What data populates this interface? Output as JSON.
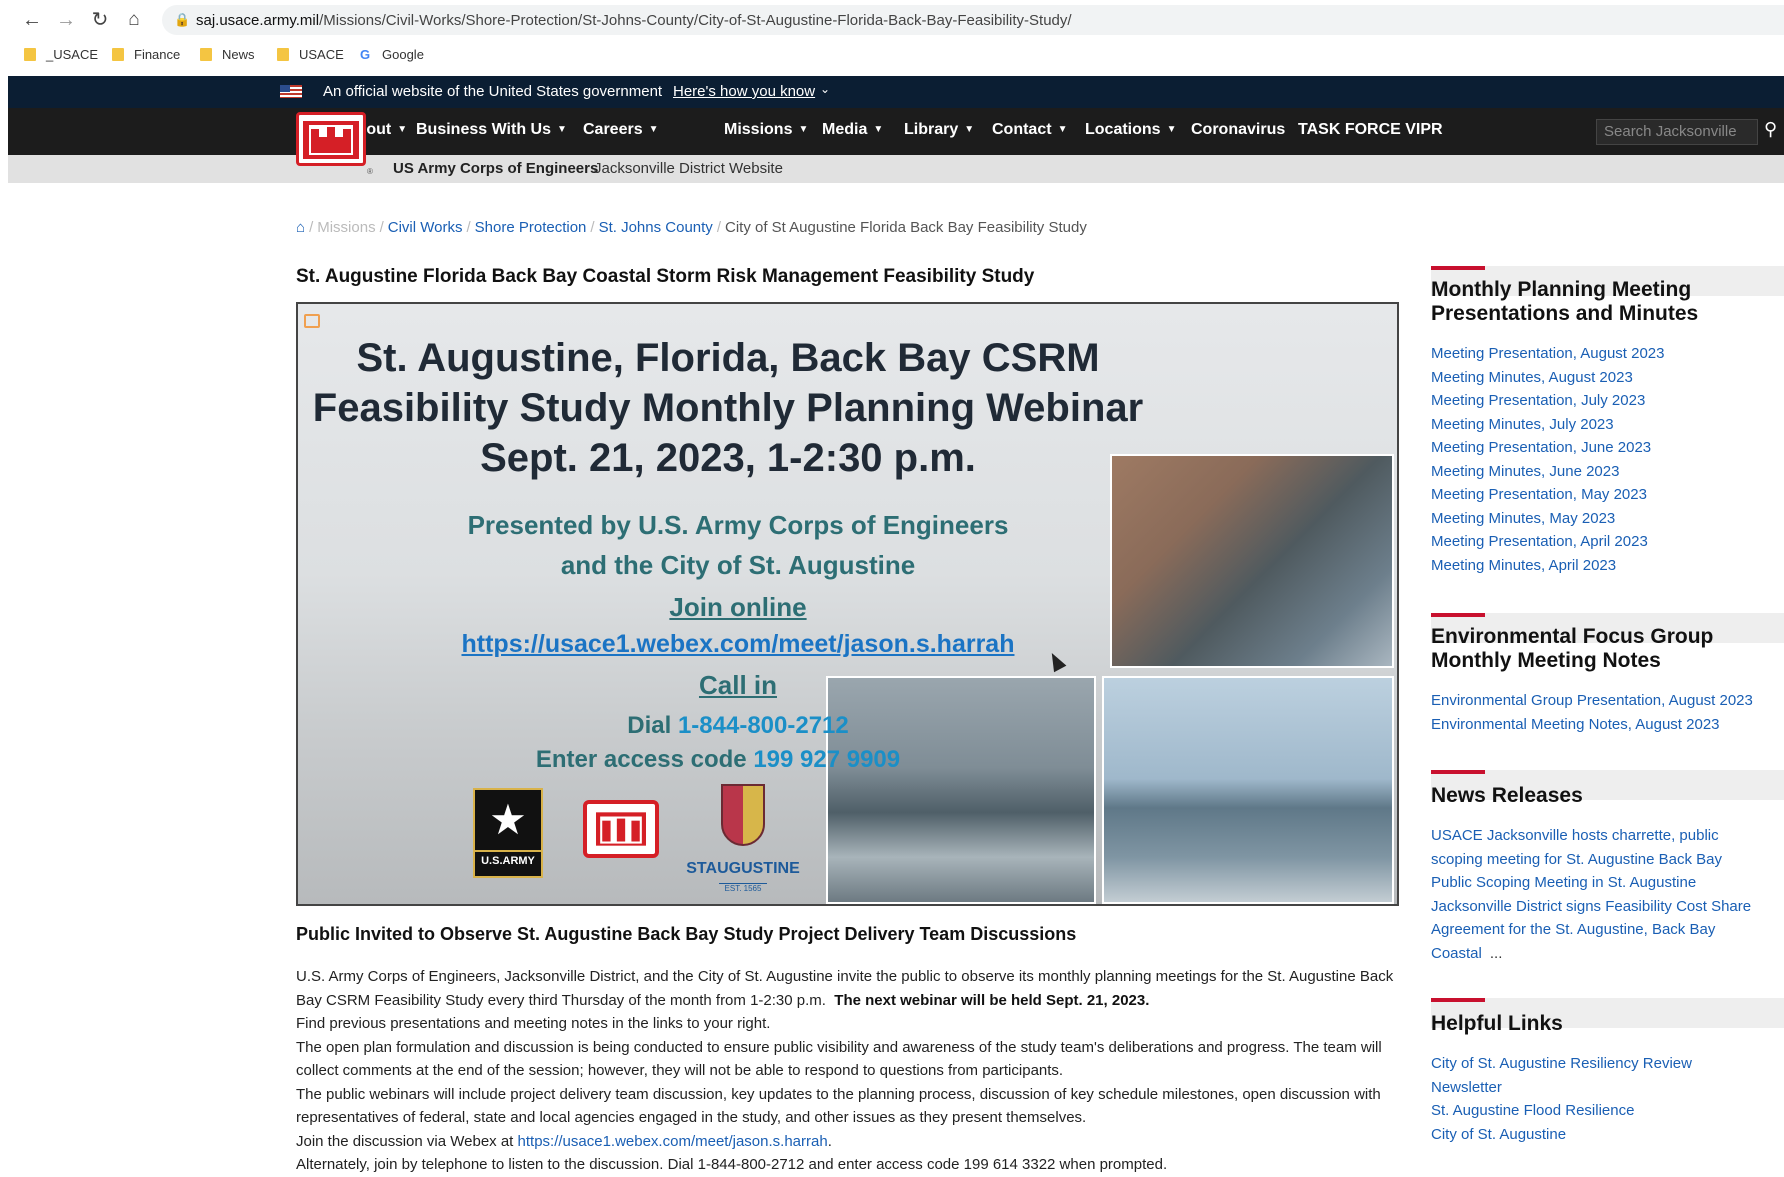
{
  "browser": {
    "url_domain": "saj.usace.army.mil",
    "url_path": "/Missions/Civil-Works/Shore-Protection/St-Johns-County/City-of-St-Augustine-Florida-Back-Bay-Feasibility-Study/",
    "bookmarks": [
      "_USACE",
      "Finance",
      "News",
      "USACE",
      "Google"
    ]
  },
  "gov_banner": {
    "text": "An official website of the United States government",
    "link": "Here's how you know"
  },
  "nav": {
    "items": [
      "About",
      "Business With Us",
      "Careers",
      "Missions",
      "Media",
      "Library",
      "Contact",
      "Locations",
      "Coronavirus",
      "TASK FORCE VIPR"
    ],
    "search_placeholder": "Search Jacksonville"
  },
  "subbar": {
    "org": "US Army Corps of Engineers",
    "site": "Jacksonville District Website"
  },
  "breadcrumb": {
    "items": [
      "Missions",
      "Civil Works",
      "Shore Protection",
      "St. Johns County"
    ],
    "current": "City of St Augustine Florida Back Bay Feasibility Study"
  },
  "page_title": "St. Augustine Florida Back Bay Coastal Storm Risk Management Feasibility Study",
  "banner": {
    "line1": "St. Augustine, Florida, Back Bay CSRM",
    "line2": "Feasibility Study Monthly Planning Webinar",
    "line3": "Sept. 21, 2023, 1-2:30 p.m.",
    "presented1": "Presented by U.S. Army Corps of Engineers",
    "presented2": "and the City of St. Augustine",
    "join": "Join online",
    "url": "https://usace1.webex.com/meet/jason.s.harrah",
    "callin": "Call in",
    "dial_label": "Dial ",
    "dial_number": "1-844-800-2712",
    "access_label": "Enter access code ",
    "access_code": "199 927 9909",
    "army_text": "U.S.ARMY",
    "staug_name": "STAUGUSTINE",
    "staug_est": "EST. 1565"
  },
  "content": {
    "subtitle": "Public Invited to Observe St. Augustine Back Bay Study Project Delivery Team Discussions",
    "p1": "U.S. Army Corps of Engineers, Jacksonville District, and the City of St. Augustine invite the public to observe its monthly planning meetings for the St. Augustine Back Bay CSRM Feasibility Study every third Thursday of the month from 1-2:30 p.m.",
    "p1_bold": "The next webinar will be held Sept. 21, 2023.",
    "p2": "Find previous presentations and meeting notes in the links to your right.",
    "p3": "The open plan formulation and discussion is being conducted to ensure public visibility and awareness of the study team's deliberations and progress. The team will collect comments at the end of the session; however, they will not be able to respond to questions from participants.",
    "p4": "The public webinars will include project delivery team discussion, key updates to the planning process, discussion of key schedule milestones, open discussion with representatives of federal, state and local agencies engaged in the study, and other issues as they present themselves.",
    "p5_prefix": "Join the discussion via Webex at ",
    "p5_link": "https://usace1.webex.com/meet/jason.s.harrah",
    "p5_suffix": ".",
    "p6": "Alternately, join by telephone to listen to the discussion. Dial 1-844-800-2712 and enter access code 199 614 3322 when prompted."
  },
  "sidebar": {
    "monthly": {
      "heading1": "Monthly Planning Meeting",
      "heading2": "Presentations and Minutes",
      "links": [
        "Meeting Presentation, August 2023",
        "Meeting Minutes, August 2023",
        "Meeting Presentation, July 2023",
        "Meeting Minutes, July 2023",
        "Meeting Presentation, June 2023",
        "Meeting Minutes, June 2023",
        "Meeting Presentation, May 2023",
        "Meeting Minutes, May 2023",
        "Meeting Presentation, April 2023",
        "Meeting Minutes, April 2023"
      ]
    },
    "env": {
      "heading1": "Environmental Focus Group",
      "heading2": "Monthly Meeting Notes",
      "links": [
        "Environmental Group Presentation, August 2023",
        "Environmental Meeting Notes, August 2023"
      ]
    },
    "news": {
      "heading": "News Releases",
      "links": [
        "USACE Jacksonville hosts charrette, public",
        "scoping meeting for St. Augustine Back Bay",
        "Public Scoping Meeting in St. Augustine",
        "Jacksonville District signs Feasibility Cost Share",
        "Agreement for the St. Augustine, Back Bay",
        "Coastal"
      ],
      "more": "..."
    },
    "helpful": {
      "heading": "Helpful Links",
      "links": [
        "City of St. Augustine Resiliency Review",
        "Newsletter",
        "St. Augustine Flood Resilience",
        "City of St. Augustine"
      ]
    }
  }
}
